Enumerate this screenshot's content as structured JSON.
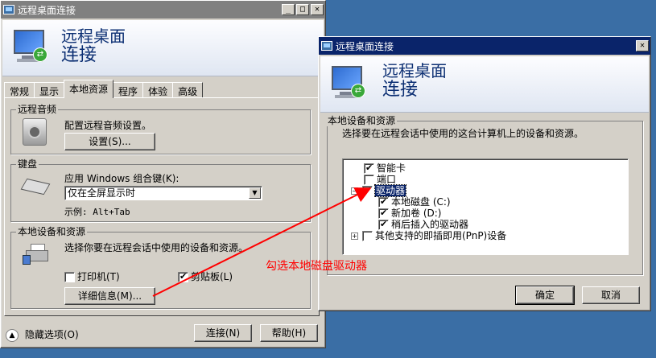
{
  "left_window": {
    "title": "远程桌面连接",
    "banner_line1": "远程桌面",
    "banner_line2": "连接",
    "tabs": [
      "常规",
      "显示",
      "本地资源",
      "程序",
      "体验",
      "高级"
    ],
    "audio": {
      "group_label": "远程音频",
      "description": "配置远程音频设置。",
      "settings_button": "设置(S)..."
    },
    "keyboard": {
      "group_label": "键盘",
      "apply_label": "应用 Windows 组合键(K):",
      "selected_option": "仅在全屏显示时",
      "example_text": "示例: Alt+Tab"
    },
    "local_devices": {
      "group_label": "本地设备和资源",
      "description": "选择你要在远程会话中使用的设备和资源。",
      "printer_label": "打印机(T)",
      "printer_checked": false,
      "clipboard_label": "剪贴板(L)",
      "clipboard_checked": true,
      "details_button": "详细信息(M)..."
    },
    "hide_options": "隐藏选项(O)",
    "connect_button": "连接(N)",
    "help_button": "帮助(H)"
  },
  "right_window": {
    "title": "远程桌面连接",
    "banner_line1": "远程桌面",
    "banner_line2": "连接",
    "group_label": "本地设备和资源",
    "description": "选择要在远程会话中使用的这台计算机上的设备和资源。",
    "tree": {
      "smart_card": "智能卡",
      "port": "端口",
      "drives": "驱动器",
      "local_disk": "本地磁盘 (C:)",
      "new_volume": "新加卷 (D:)",
      "later_drives": "稍后插入的驱动器",
      "pnp_devices": "其他支持的即插即用(PnP)设备"
    },
    "ok_button": "确定",
    "cancel_button": "取消"
  },
  "annotation": {
    "text": "勾选本地磁盘驱动器",
    "color": "#ff0000"
  }
}
